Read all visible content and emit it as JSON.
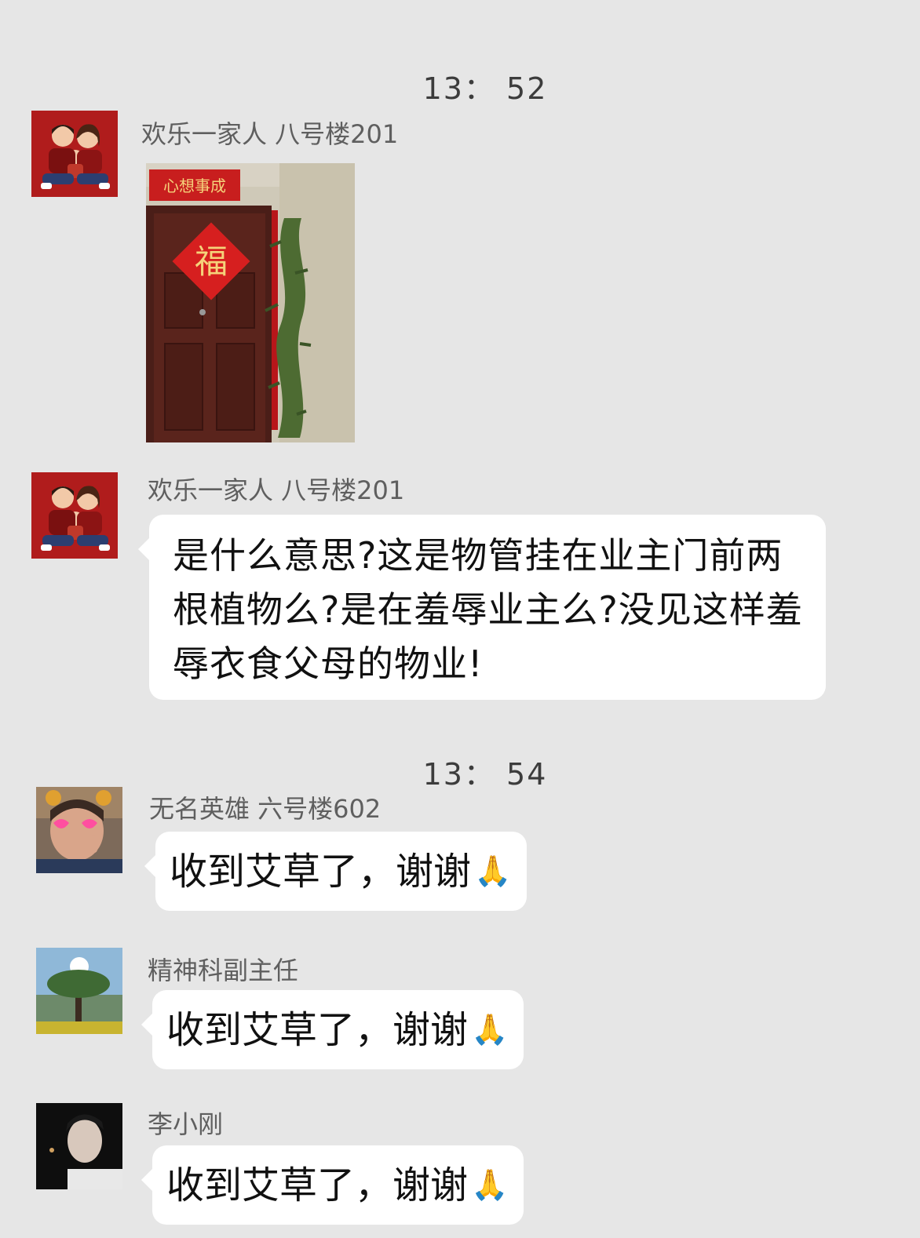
{
  "timestamps": [
    "13： 52",
    "13： 54"
  ],
  "messages": [
    {
      "sender": "欢乐一家人 八号楼201",
      "type": "image",
      "image": {
        "banner": "心想事成",
        "fu": "福"
      }
    },
    {
      "sender": "欢乐一家人 八号楼201",
      "type": "text",
      "text": "是什么意思?这是物管挂在业主门前两根植物么?是在羞辱业主么?没见这样羞辱衣食父母的物业!"
    },
    {
      "sender": "无名英雄 六号楼602",
      "type": "text",
      "text": "收到艾草了，谢谢",
      "emoji": "🙏"
    },
    {
      "sender": "精神科副主任",
      "type": "text",
      "text": "收到艾草了，谢谢",
      "emoji": "🙏"
    },
    {
      "sender": "李小刚",
      "type": "text",
      "text": "收到艾草了，谢谢",
      "emoji": "🙏"
    }
  ],
  "colors": {
    "background": "#e6e6e6",
    "bubble": "#ffffff",
    "avatar_red": "#b01c1c"
  },
  "icons": [
    "pray-emoji-icon"
  ]
}
